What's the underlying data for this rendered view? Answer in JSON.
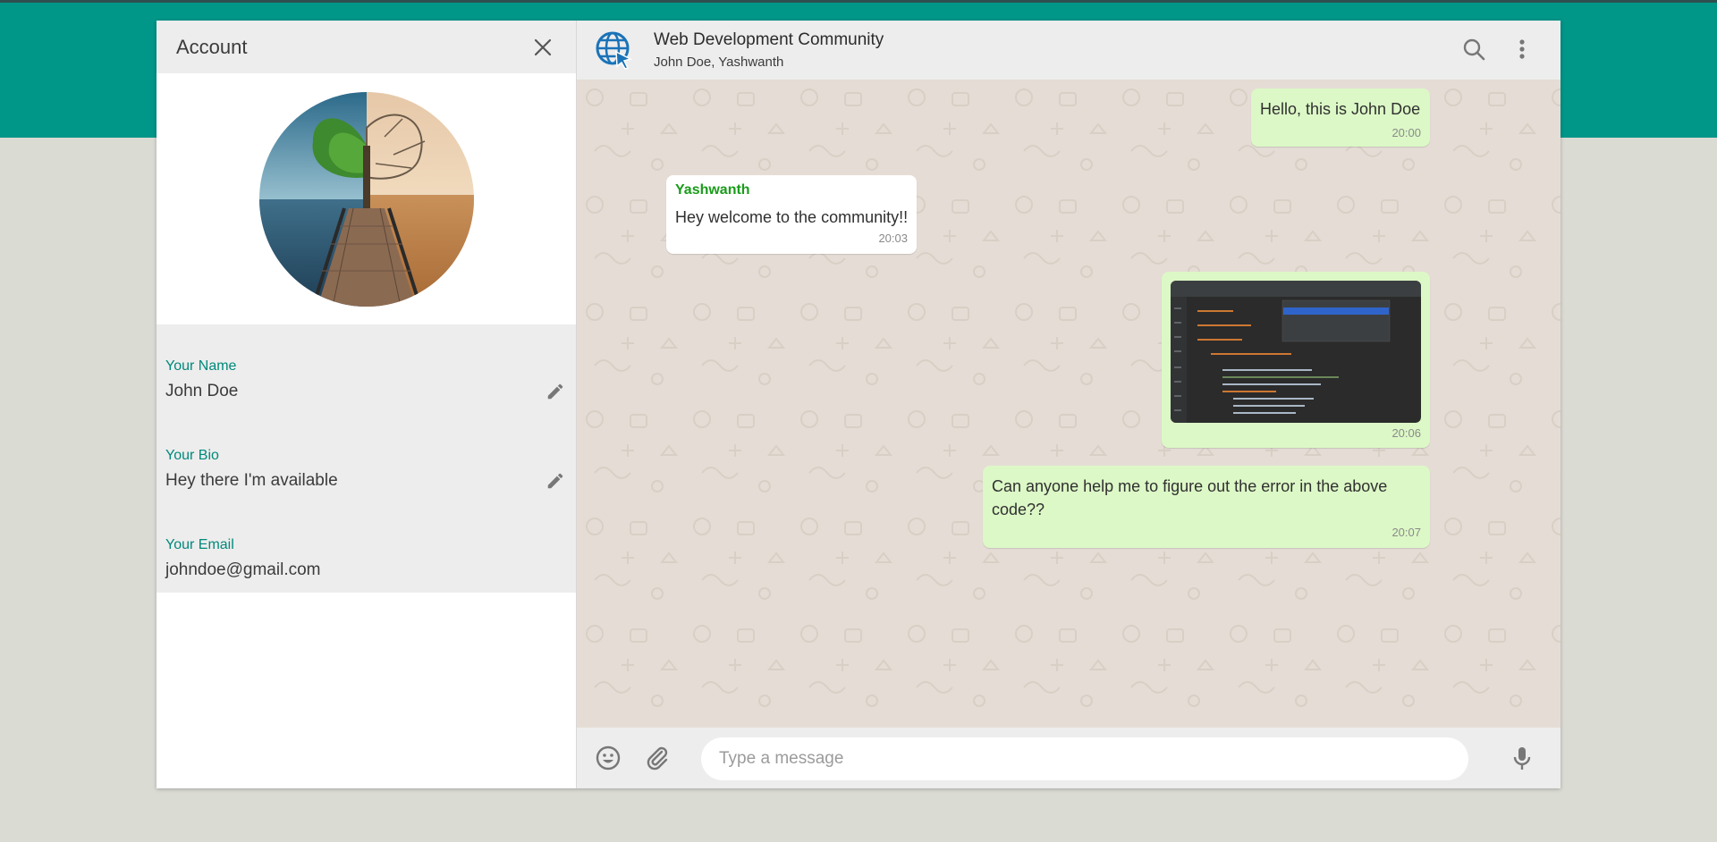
{
  "account": {
    "title": "Account",
    "fields": [
      {
        "label": "Your Name",
        "value": "John Doe",
        "editable": true
      },
      {
        "label": "Your Bio",
        "value": "Hey there I'm available",
        "editable": true
      },
      {
        "label": "Your Email",
        "value": "johndoe@gmail.com",
        "editable": false
      }
    ]
  },
  "chat": {
    "group_name": "Web Development Community",
    "members": "John Doe, Yashwanth",
    "messages": [
      {
        "direction": "out",
        "text": "Hello, this is John Doe",
        "time": "20:00"
      },
      {
        "direction": "in",
        "sender": "Yashwanth",
        "text": "Hey welcome to the community!!",
        "time": "20:03"
      },
      {
        "direction": "out",
        "type": "image",
        "time": "20:06"
      },
      {
        "direction": "out",
        "text": "Can anyone help me to figure out the error in the above code??",
        "time": "20:07"
      }
    ],
    "input_placeholder": "Type a message"
  },
  "colors": {
    "accent": "#009688",
    "outgoing_bubble": "#dcf8c6",
    "incoming_bubble": "#ffffff",
    "sender_name": "#1a9c1a",
    "chat_bg": "#e5ddd5"
  },
  "icons": [
    "close-icon",
    "group-globe-icon",
    "search-icon",
    "menu-dots-icon",
    "edit-pencil-icon",
    "emoji-icon",
    "attach-icon",
    "mic-icon"
  ]
}
